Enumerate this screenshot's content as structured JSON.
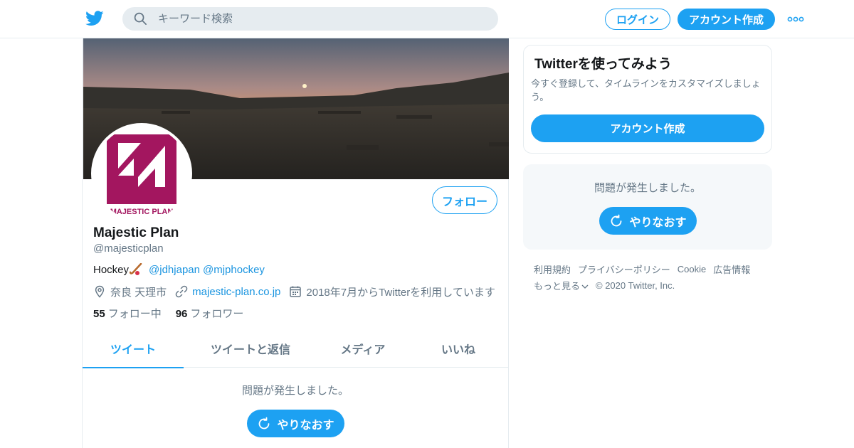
{
  "header": {
    "search_placeholder": "キーワード検索",
    "login_label": "ログイン",
    "signup_label": "アカウント作成"
  },
  "profile": {
    "display_name": "Majestic Plan",
    "handle": "@majesticplan",
    "bio_prefix": "Hockey",
    "bio_mentions": [
      "@jdhjapan",
      "@mjphockey"
    ],
    "location": "奈良 天理市",
    "website": "majestic-plan.co.jp",
    "joined": "2018年7月からTwitterを利用しています",
    "following_count": "55",
    "following_label": "フォロー中",
    "followers_count": "96",
    "followers_label": "フォロワー",
    "follow_button": "フォロー",
    "avatar_text": "MAJESTIC PLAN"
  },
  "tabs": [
    {
      "label": "ツイート",
      "active": true
    },
    {
      "label": "ツイートと返信",
      "active": false
    },
    {
      "label": "メディア",
      "active": false
    },
    {
      "label": "いいね",
      "active": false
    }
  ],
  "timeline": {
    "error_text": "問題が発生しました。",
    "retry_label": "やりなおす"
  },
  "sidebar": {
    "title": "Twitterを使ってみよう",
    "description": "今すぐ登録して、タイムラインをカスタマイズしましょう。",
    "signup_label": "アカウント作成",
    "error_text": "問題が発生しました。",
    "retry_label": "やりなおす"
  },
  "footer": {
    "links": [
      "利用規約",
      "プライバシーポリシー",
      "Cookie",
      "広告情報"
    ],
    "more_label": "もっと見る",
    "copyright": "© 2020 Twitter, Inc."
  },
  "colors": {
    "accent": "#1da1f2",
    "link": "#1b95e0",
    "muted": "#657786",
    "logo_magenta": "#a3165f"
  }
}
